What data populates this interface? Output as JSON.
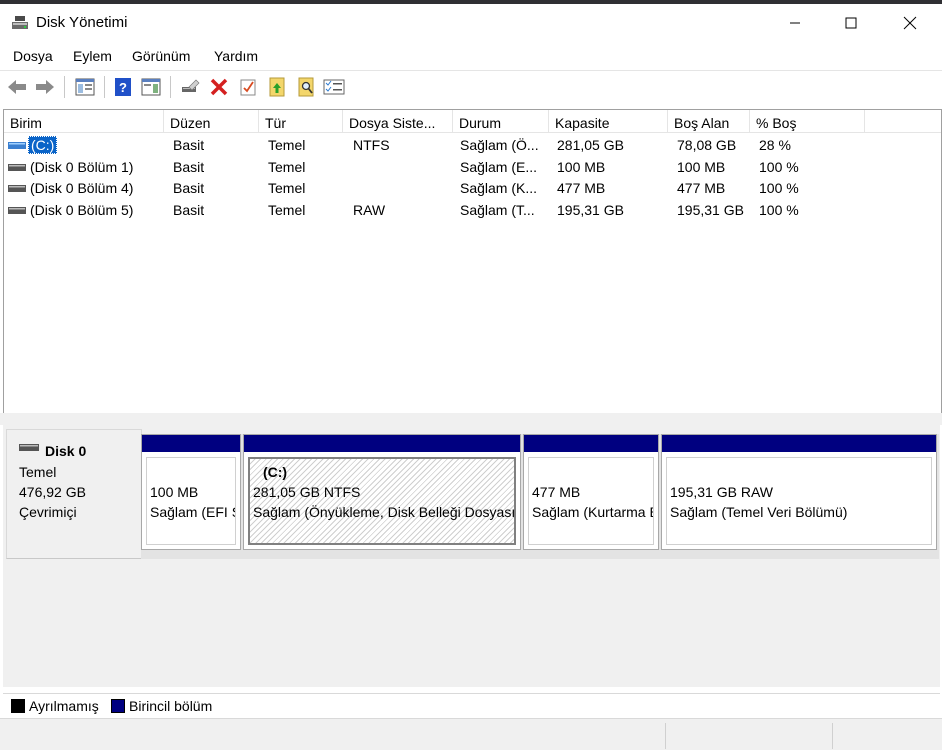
{
  "window": {
    "title": "Disk Yönetimi",
    "minimize_icon": "minimize-icon",
    "maximize_icon": "maximize-icon",
    "close_icon": "close-icon"
  },
  "menu": [
    "Dosya",
    "Eylem",
    "Görünüm",
    "Yardım"
  ],
  "toolbar": {
    "icons": [
      "back-arrow-icon",
      "forward-arrow-icon",
      "console-tree-icon",
      "help-icon",
      "properties-pane-icon",
      "connect-drive-icon",
      "delete-icon",
      "check-icon",
      "export-icon",
      "search-icon",
      "list-icon"
    ]
  },
  "volume_table": {
    "columns": [
      "Birim",
      "Düzen",
      "Tür",
      "Dosya Siste...",
      "Durum",
      "Kapasite",
      "Boş Alan",
      "% Boş"
    ],
    "rows": [
      {
        "name": "(C:)",
        "layout": "Basit",
        "type": "Temel",
        "fs": "NTFS",
        "status": "Sağlam (Ö...",
        "capacity": "281,05 GB",
        "free": "78,08 GB",
        "pct": "28 %",
        "selected": true
      },
      {
        "name": "(Disk 0 Bölüm 1)",
        "layout": "Basit",
        "type": "Temel",
        "fs": "",
        "status": "Sağlam (E...",
        "capacity": "100 MB",
        "free": "100 MB",
        "pct": "100 %"
      },
      {
        "name": "(Disk 0 Bölüm 4)",
        "layout": "Basit",
        "type": "Temel",
        "fs": "",
        "status": "Sağlam (K...",
        "capacity": "477 MB",
        "free": "477 MB",
        "pct": "100 %"
      },
      {
        "name": "(Disk 0 Bölüm 5)",
        "layout": "Basit",
        "type": "Temel",
        "fs": "RAW",
        "status": "Sağlam (T...",
        "capacity": "195,31 GB",
        "free": "195,31 GB",
        "pct": "100 %"
      }
    ]
  },
  "disk": {
    "name": "Disk 0",
    "type": "Temel",
    "size": "476,92 GB",
    "state": "Çevrimiçi",
    "partitions": [
      {
        "label": "",
        "size": "100 MB",
        "status": "Sağlam (EFI Sistem Bölümü)"
      },
      {
        "label": "(C:)",
        "size": "281,05 GB NTFS",
        "status": "Sağlam (Önyükleme, Disk Belleği Dosyası, Kilitlenme Bilgi Dökümü, Birincil Bölüm)"
      },
      {
        "label": "",
        "size": "477 MB",
        "status": "Sağlam (Kurtarma Bölümü)"
      },
      {
        "label": "",
        "size": "195,31 GB RAW",
        "status": "Sağlam (Temel Veri Bölümü)"
      }
    ]
  },
  "legend": {
    "unallocated": "Ayrılmamış",
    "primary": "Birincil bölüm",
    "colors": {
      "unallocated": "#000000",
      "primary": "#000080"
    }
  }
}
